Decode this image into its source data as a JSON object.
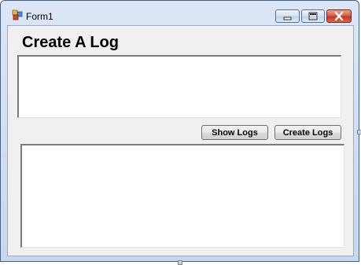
{
  "window": {
    "title": "Form1",
    "icon": "windows-form-icon",
    "controls": [
      "minimize-icon",
      "maximize-icon",
      "close-icon"
    ]
  },
  "form": {
    "heading": "Create A Log",
    "log_input_value": "",
    "log_output_value": "",
    "show_logs_label": "Show Logs",
    "create_logs_label": "Create Logs"
  },
  "colors": {
    "frame": "#c6d8ef",
    "client_bg": "#f0f0f0",
    "close_button": "#c3371d"
  }
}
